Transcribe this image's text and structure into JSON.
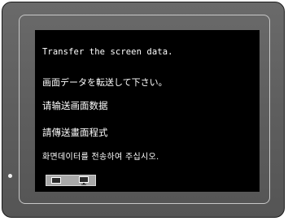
{
  "screen": {
    "messages": {
      "en": "Transfer the screen data.",
      "ja": "画面データを転送して下さい。",
      "zh_hans": "请输送画面数据",
      "zh_hant": "請傳送畫面程式",
      "ko": "화면데이터를 전송하여 주십시오."
    },
    "transfer_graphic": {
      "source_icon": "terminal-device-icon",
      "target_icon": "monitor-icon"
    }
  },
  "colors": {
    "bezel": "#5e5e5e",
    "frame_line": "#c8c8c8",
    "screen_background": "#000000",
    "screen_text": "#ffffff",
    "graphic_background": "#a8a8a8"
  }
}
